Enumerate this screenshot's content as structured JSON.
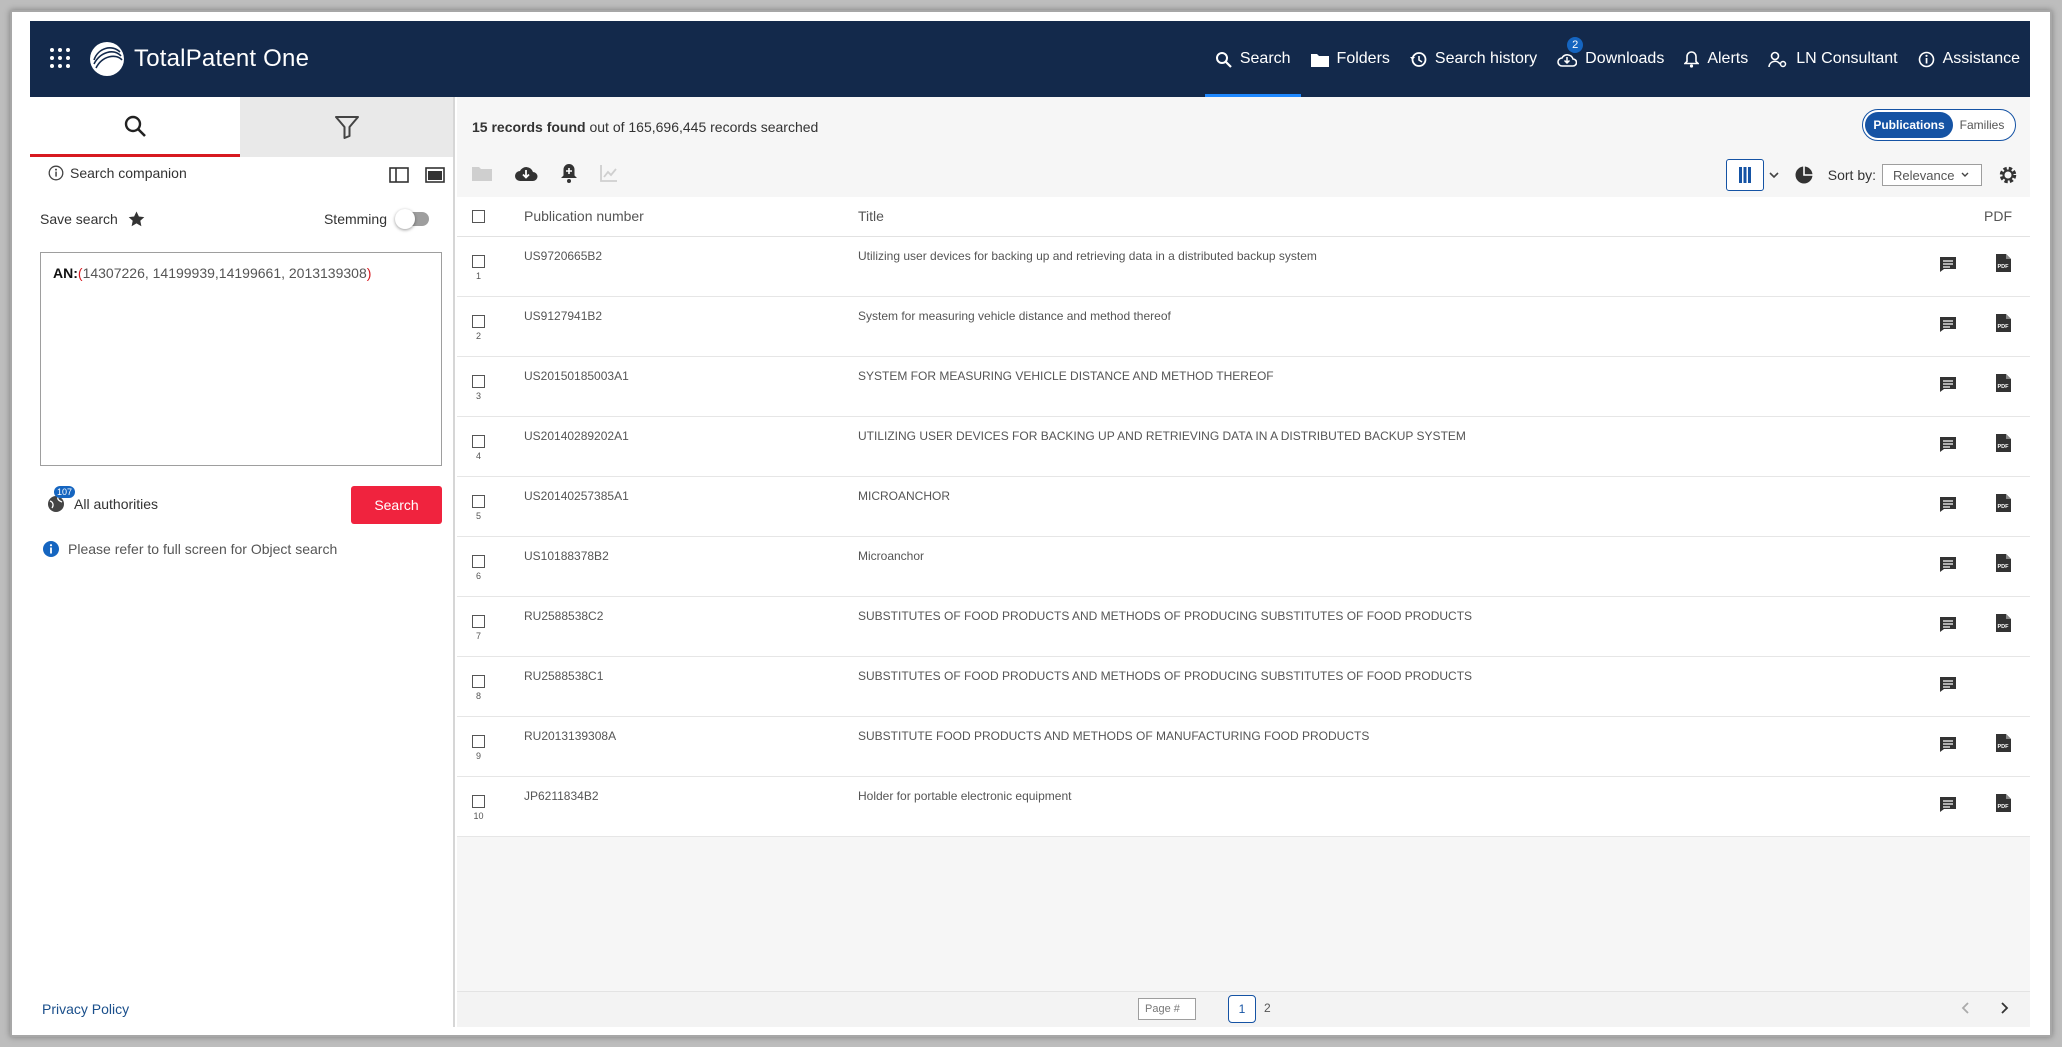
{
  "app": {
    "title": "TotalPatent One"
  },
  "nav": {
    "search": "Search",
    "folders": "Folders",
    "history": "Search history",
    "downloads": "Downloads",
    "downloads_badge": "2",
    "alerts": "Alerts",
    "consultant": "LN Consultant",
    "assistance": "Assistance"
  },
  "left": {
    "companion": "Search companion",
    "save_search": "Save search",
    "stemming": "Stemming",
    "query": {
      "prefix": "AN:",
      "open": "(",
      "values": "14307226, 14199939,14199661, 2013139308",
      "close": ")"
    },
    "authorities_count": "107",
    "authorities": "All authorities",
    "search_button": "Search",
    "info": "Please refer to full screen for Object search",
    "privacy": "Privacy Policy"
  },
  "results": {
    "count_bold": "15 records found",
    "count_rest": " out of 165,696,445 records searched",
    "toggle_publications": "Publications",
    "toggle_families": "Families",
    "sort_label": "Sort by:",
    "sort_value": "Relevance",
    "columns": {
      "pub": "Publication number",
      "title": "Title",
      "pdf": "PDF"
    },
    "rows": [
      {
        "num": "1",
        "pub": "US9720665B2",
        "title": "Utilizing user devices for backing up and retrieving data in a distributed backup system",
        "pdf": true
      },
      {
        "num": "2",
        "pub": "US9127941B2",
        "title": "System for measuring vehicle distance and method thereof",
        "pdf": true
      },
      {
        "num": "3",
        "pub": "US20150185003A1",
        "title": "SYSTEM FOR MEASURING VEHICLE DISTANCE AND METHOD THEREOF",
        "pdf": true
      },
      {
        "num": "4",
        "pub": "US20140289202A1",
        "title": "UTILIZING USER DEVICES FOR BACKING UP AND RETRIEVING DATA IN A DISTRIBUTED BACKUP SYSTEM",
        "pdf": true
      },
      {
        "num": "5",
        "pub": "US20140257385A1",
        "title": "MICROANCHOR",
        "pdf": true
      },
      {
        "num": "6",
        "pub": "US10188378B2",
        "title": "Microanchor",
        "pdf": true
      },
      {
        "num": "7",
        "pub": "RU2588538C2",
        "title": "SUBSTITUTES OF FOOD PRODUCTS AND METHODS OF PRODUCING SUBSTITUTES OF FOOD PRODUCTS",
        "pdf": true
      },
      {
        "num": "8",
        "pub": "RU2588538C1",
        "title": "SUBSTITUTES OF FOOD PRODUCTS AND METHODS OF PRODUCING SUBSTITUTES OF FOOD PRODUCTS",
        "pdf": false
      },
      {
        "num": "9",
        "pub": "RU2013139308A",
        "title": "SUBSTITUTE FOOD PRODUCTS AND METHODS OF MANUFACTURING FOOD PRODUCTS",
        "pdf": true
      },
      {
        "num": "10",
        "pub": "JP6211834B2",
        "title": "Holder for portable electronic equipment",
        "pdf": true
      }
    ],
    "page_placeholder": "Page #",
    "pages": [
      "1",
      "2"
    ]
  }
}
